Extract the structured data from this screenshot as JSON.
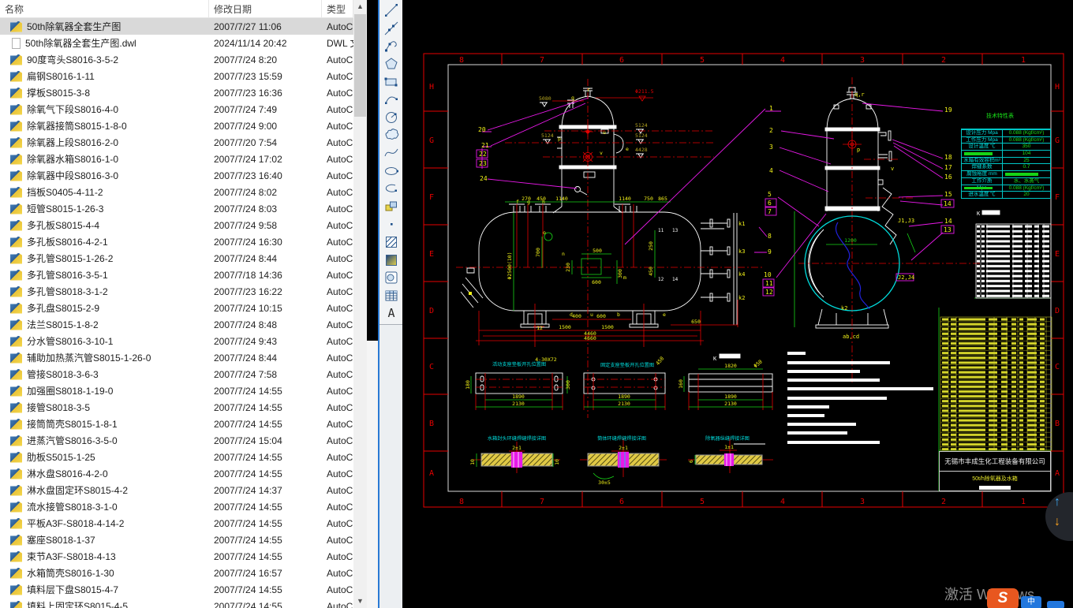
{
  "explorer": {
    "columns": [
      "名称",
      "修改日期",
      "类型"
    ],
    "files": [
      {
        "name": "50th除氧器全套生产图",
        "date": "2007/7/27 11:06",
        "type": "AutoC",
        "selected": true
      },
      {
        "name": "50th除氧器全套生产图.dwl",
        "date": "2024/11/14 20:42",
        "type": "DWL 文",
        "icon": "dwl"
      },
      {
        "name": "90度弯头S8016-3-5-2",
        "date": "2007/7/24 8:20",
        "type": "AutoC"
      },
      {
        "name": "扁钢S8016-1-11",
        "date": "2007/7/23 15:59",
        "type": "AutoC"
      },
      {
        "name": "撑板S8015-3-8",
        "date": "2007/7/23 16:36",
        "type": "AutoC"
      },
      {
        "name": "除氧气下段S8016-4-0",
        "date": "2007/7/24 7:49",
        "type": "AutoC"
      },
      {
        "name": "除氧器接筒S8015-1-8-0",
        "date": "2007/7/24 9:00",
        "type": "AutoC"
      },
      {
        "name": "除氧器上段S8016-2-0",
        "date": "2007/7/20 7:54",
        "type": "AutoC"
      },
      {
        "name": "除氧器水箱S8016-1-0",
        "date": "2007/7/24 17:02",
        "type": "AutoC"
      },
      {
        "name": "除氧器中段S8016-3-0",
        "date": "2007/7/23 16:40",
        "type": "AutoC"
      },
      {
        "name": "挡板S0405-4-11-2",
        "date": "2007/7/24 8:02",
        "type": "AutoC"
      },
      {
        "name": "短管S8015-1-26-3",
        "date": "2007/7/24 8:03",
        "type": "AutoC"
      },
      {
        "name": "多孔板S8015-4-4",
        "date": "2007/7/24 9:58",
        "type": "AutoC"
      },
      {
        "name": "多孔板S8016-4-2-1",
        "date": "2007/7/24 16:30",
        "type": "AutoC"
      },
      {
        "name": "多孔管S8015-1-26-2",
        "date": "2007/7/24 8:44",
        "type": "AutoC"
      },
      {
        "name": "多孔管S8016-3-5-1",
        "date": "2007/7/18 14:36",
        "type": "AutoC"
      },
      {
        "name": "多孔管S8018-3-1-2",
        "date": "2007/7/23 16:22",
        "type": "AutoC"
      },
      {
        "name": "多孔盘S8015-2-9",
        "date": "2007/7/24 10:15",
        "type": "AutoC"
      },
      {
        "name": "法兰S8015-1-8-2",
        "date": "2007/7/24 8:48",
        "type": "AutoC"
      },
      {
        "name": "分水管S8016-3-10-1",
        "date": "2007/7/24 9:43",
        "type": "AutoC"
      },
      {
        "name": "辅助加热蒸汽管S8015-1-26-0",
        "date": "2007/7/24 8:44",
        "type": "AutoC"
      },
      {
        "name": "管接S8018-3-6-3",
        "date": "2007/7/24 7:58",
        "type": "AutoC"
      },
      {
        "name": "加强圈S8018-1-19-0",
        "date": "2007/7/24 14:55",
        "type": "AutoC"
      },
      {
        "name": "接管S8018-3-5",
        "date": "2007/7/24 14:55",
        "type": "AutoC"
      },
      {
        "name": "接筒筒壳S8015-1-8-1",
        "date": "2007/7/24 14:55",
        "type": "AutoC"
      },
      {
        "name": "进蒸汽管S8016-3-5-0",
        "date": "2007/7/24 15:04",
        "type": "AutoC"
      },
      {
        "name": "肋板S5015-1-25",
        "date": "2007/7/24 14:55",
        "type": "AutoC"
      },
      {
        "name": "淋水盘S8016-4-2-0",
        "date": "2007/7/24 14:55",
        "type": "AutoC"
      },
      {
        "name": "淋水盘固定环S8015-4-2",
        "date": "2007/7/24 14:37",
        "type": "AutoC"
      },
      {
        "name": "流水接管S8018-3-1-0",
        "date": "2007/7/24 14:55",
        "type": "AutoC"
      },
      {
        "name": "平板A3F-S8018-4-14-2",
        "date": "2007/7/24 14:55",
        "type": "AutoC"
      },
      {
        "name": "塞座S8018-1-37",
        "date": "2007/7/24 14:55",
        "type": "AutoC"
      },
      {
        "name": "束节A3F-S8018-4-13",
        "date": "2007/7/24 14:55",
        "type": "AutoC"
      },
      {
        "name": "水箱筒壳S8016-1-30",
        "date": "2007/7/24 16:57",
        "type": "AutoC"
      },
      {
        "name": "填料层下盘S8015-4-7",
        "date": "2007/7/24 14:55",
        "type": "AutoC"
      },
      {
        "name": "填料上固定环S8015-4-5",
        "date": "2007/7/24 14:55",
        "type": "AutoC"
      }
    ]
  },
  "toolbar": {
    "tools": [
      "line",
      "construction-line",
      "polyline",
      "polygon",
      "rectangle",
      "arc",
      "circle",
      "revision-cloud",
      "spline",
      "ellipse",
      "ellipse-arc",
      "insert-block",
      "point",
      "hatch",
      "gradient",
      "region",
      "table",
      "multiline-text"
    ],
    "mtext_glyph": "A"
  },
  "cad": {
    "grid": {
      "cols": [
        "8",
        "7",
        "6",
        "5",
        "4",
        "3",
        "2",
        "1"
      ],
      "rows": [
        "H",
        "G",
        "F",
        "E",
        "D",
        "C",
        "B",
        "A"
      ]
    },
    "front": {
      "callouts": [
        "20",
        "21",
        "22",
        "23",
        "24"
      ],
      "elev": [
        "5080",
        "Φ211.5",
        "5124",
        "5124",
        "5124",
        "4428"
      ],
      "dims_top": [
        "270",
        "450",
        "1140",
        "1140",
        "750",
        "865"
      ],
      "dims_mid": [
        "Φ2500(10)",
        "700",
        "230",
        "500",
        "600",
        "300",
        "250",
        "450"
      ],
      "dims_bottom": [
        "400",
        "600",
        "12",
        "1500",
        "1500",
        "4460",
        "4660",
        "650"
      ],
      "letters": [
        "r",
        "q",
        "p",
        "u",
        "v",
        "e",
        "o",
        "n",
        "m",
        "f",
        "g",
        "h"
      ],
      "letters_bottom": [
        "d",
        "u",
        "b",
        "e"
      ],
      "weld_nums": [
        "11",
        "13",
        "12",
        "14"
      ],
      "k_labels": [
        "k1",
        "k3",
        "k4",
        "k2"
      ]
    },
    "side": {
      "callouts_left": [
        "1",
        "2",
        "3",
        "4",
        "5",
        "6",
        "7",
        "8",
        "9",
        "10",
        "11",
        "12"
      ],
      "callouts_right": [
        "19",
        "18",
        "17",
        "16",
        "15",
        "14",
        "14",
        "13"
      ],
      "labels": [
        "q,r",
        "p",
        "v",
        "k2",
        "ab,cd",
        "J1,J3",
        "J2,J4",
        "1200"
      ]
    },
    "details": {
      "titles": [
        "活动支座垫板开孔位置图",
        "固定支座垫板开孔位置图"
      ],
      "k": "K",
      "dims": [
        "4-30X72",
        "1890",
        "2130",
        "180",
        "300",
        "1890",
        "2130",
        "450",
        "1820",
        "1890",
        "2130",
        "160",
        "Φ50"
      ]
    },
    "welds": {
      "titles": [
        "水箱封头环缝焊缝焊接详图",
        "筒体环缝焊缝焊接详图",
        "除氧器纵缝焊接详图"
      ],
      "dims": [
        "2±1",
        "2±1",
        "1±1",
        "30±5",
        "10",
        "10",
        "6"
      ]
    },
    "tech_table": {
      "title": "技术特性表",
      "rows": [
        {
          "label": "设计压力 Mpa",
          "value": "0.088 (Kgf/cm²)"
        },
        {
          "label": "工作压力 Mpa",
          "value": "0.088 (Kgf/cm²)"
        },
        {
          "label": "设计温度 ℃",
          "value": "350"
        },
        {
          "label": "",
          "lbar": true,
          "value": "104"
        },
        {
          "label": "水箱有效容积m³",
          "value": "25"
        },
        {
          "label": "焊缝系数",
          "value": "0.7"
        },
        {
          "label": "腐蚀裕度 mm",
          "value": "",
          "vbar": true
        },
        {
          "label": "工作介质",
          "value": "水、水蒸气"
        },
        {
          "label": "Mpa",
          "lbar": true,
          "value": "0.088 (Kgf/cm²)"
        },
        {
          "label": "进水温度 ℃",
          "value": "20"
        }
      ]
    },
    "title_block": {
      "company": "无锡市丰成生化工程装备有限公司",
      "product": "50t/h除氧器及水箱"
    }
  },
  "overlay": {
    "watermark": "激活 Windows",
    "ime_s": "S",
    "ime_zh": "中",
    "scroll_up": "↑",
    "scroll_down": "↓"
  },
  "colors": {
    "cad_red": "#e60000",
    "cad_green": "#17d417",
    "cad_yellow": "#f2f219",
    "cad_cyan": "#00dcdc",
    "cad_magenta": "#e819e8",
    "cad_olive": "#b5a51f",
    "selection_gray": "#d9d9d9",
    "accent_blue": "#2a7ad4"
  }
}
